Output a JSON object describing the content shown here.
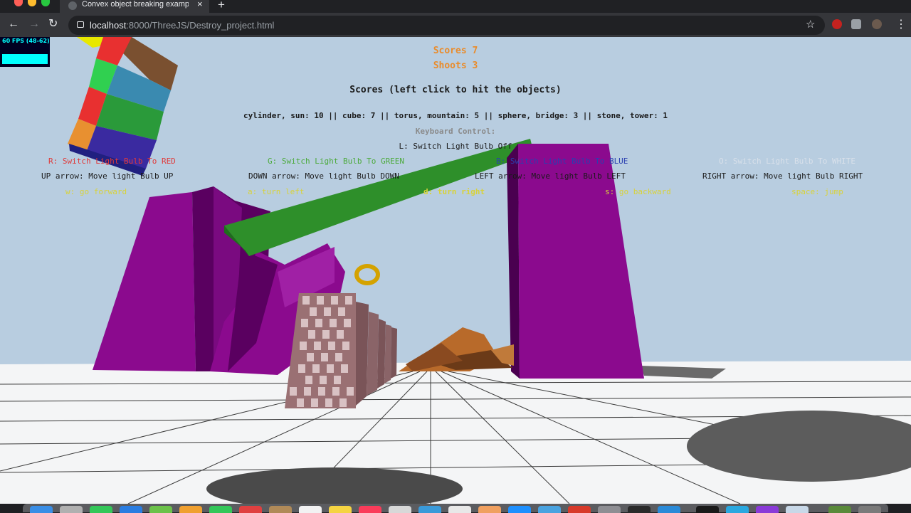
{
  "browser": {
    "tab_title": "Convex object breaking example",
    "tab_close": "×",
    "new_tab": "+",
    "url_host": "localhost",
    "url_path": ":8000/ThreeJS/Destroy_project.html"
  },
  "stats": {
    "fps": "60 FPS (48-62)"
  },
  "hud": {
    "scores_line": "Scores 7",
    "shoots_line": "Shoots 3",
    "scores_title": "Scores (left click to hit the objects)",
    "score_table": "cylinder, sun: 10 || cube: 7 || torus, mountain: 5 || sphere, bridge: 3 || stone, tower: 1",
    "keyboard_title": "Keyboard Control:",
    "light_off": "L: Switch Light Bulb Off",
    "red": "R: Switch Light Bulb To RED",
    "green": "G: Switch Light Bulb To GREEN",
    "blue": "B: Switch Light Bulb To BLUE",
    "white": "O: Switch Light Bulb To WHITE",
    "up": "UP arrow: Move light Bulb UP",
    "down": "DOWN arrow: Move light Bulb DOWN",
    "left": "LEFT arrow: Move light Bulb LEFT",
    "right": "RIGHT arrow: Move light Bulb RIGHT",
    "w": "w: go forward",
    "a": "a: turn left",
    "d": "d: turn right",
    "s": "s: go backward",
    "space": "space: jump"
  },
  "colors": {
    "score_orange": "#e98c2c",
    "red_text": "#e03a3a",
    "green_text": "#4caa3c",
    "blue_text": "#2a3fb0",
    "white_text": "#d8e0ea",
    "yellow_text": "#d8d23a",
    "gray_text": "#8a8a8a",
    "sky": "#b8cde0",
    "purple": "#8b0a8e",
    "beam": "#2e8f2a"
  }
}
